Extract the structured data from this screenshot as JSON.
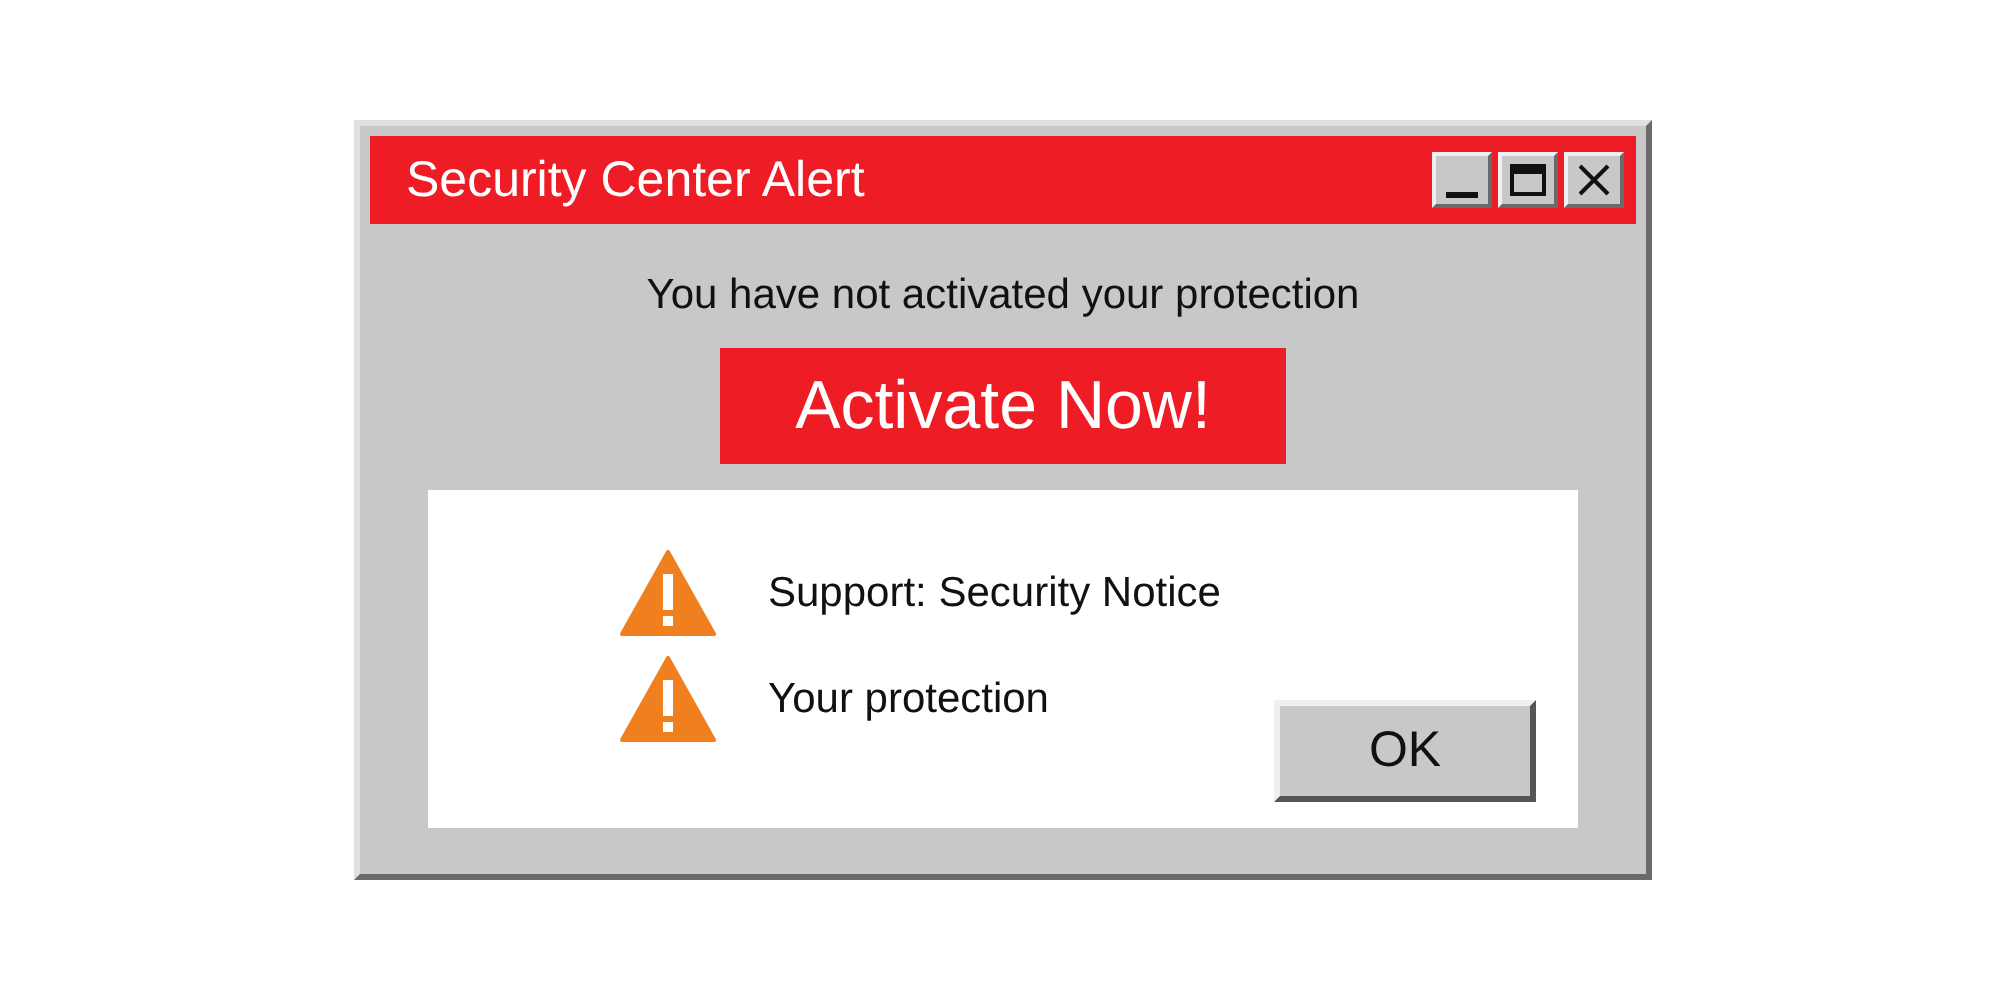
{
  "window": {
    "title": "Security Center Alert",
    "controls": [
      {
        "kind": "minimize"
      },
      {
        "kind": "maximize"
      },
      {
        "kind": "close"
      }
    ]
  },
  "message": "You have not activated your protection",
  "action_button": "Activate Now!",
  "notices": [
    {
      "text": "Support: Security Notice"
    },
    {
      "text": "Your protection"
    }
  ],
  "buttons": [
    "OK"
  ]
}
